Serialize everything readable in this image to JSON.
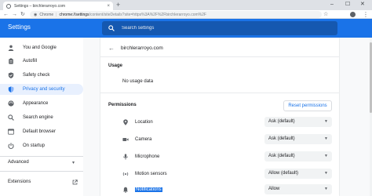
{
  "browser": {
    "tab_title": "Settings – birchlerarroyo.com",
    "tab_close": "×",
    "new_tab": "+",
    "win_min": "–",
    "win_max": "☐",
    "win_close": "✕",
    "scheme_label": "Chrome",
    "url_host": "chrome://settings",
    "url_rest": "/content/siteDetails?site=https%3A%2F%2Fbirchlerarroyo.com%2F"
  },
  "header": {
    "title": "Settings",
    "search_placeholder": "Search settings"
  },
  "sidebar": {
    "items": [
      {
        "label": "You and Google",
        "icon": "person-icon"
      },
      {
        "label": "Autofill",
        "icon": "clipboard-icon"
      },
      {
        "label": "Safety check",
        "icon": "shield-check-icon"
      },
      {
        "label": "Privacy and security",
        "icon": "shield-icon",
        "active": true
      },
      {
        "label": "Appearance",
        "icon": "palette-icon"
      },
      {
        "label": "Search engine",
        "icon": "search-icon"
      },
      {
        "label": "Default browser",
        "icon": "browser-icon"
      },
      {
        "label": "On startup",
        "icon": "power-icon"
      }
    ],
    "advanced_label": "Advanced",
    "extensions_label": "Extensions"
  },
  "main": {
    "site": "birchlerarroyo.com",
    "usage_title": "Usage",
    "usage_value": "No usage data",
    "permissions_title": "Permissions",
    "reset_label": "Reset permissions",
    "permissions": [
      {
        "label": "Location",
        "value": "Ask (default)",
        "icon": "location-icon"
      },
      {
        "label": "Camera",
        "value": "Ask (default)",
        "icon": "camera-icon"
      },
      {
        "label": "Microphone",
        "value": "Ask (default)",
        "icon": "microphone-icon"
      },
      {
        "label": "Motion sensors",
        "value": "Allow (default)",
        "icon": "motion-sensor-icon"
      },
      {
        "label": "Notifications",
        "value": "Allow",
        "icon": "bell-icon"
      }
    ]
  },
  "colors": {
    "accent": "#1a73e8",
    "header_bg": "#1a73e8",
    "active_nav_bg": "#e8f0fe"
  }
}
